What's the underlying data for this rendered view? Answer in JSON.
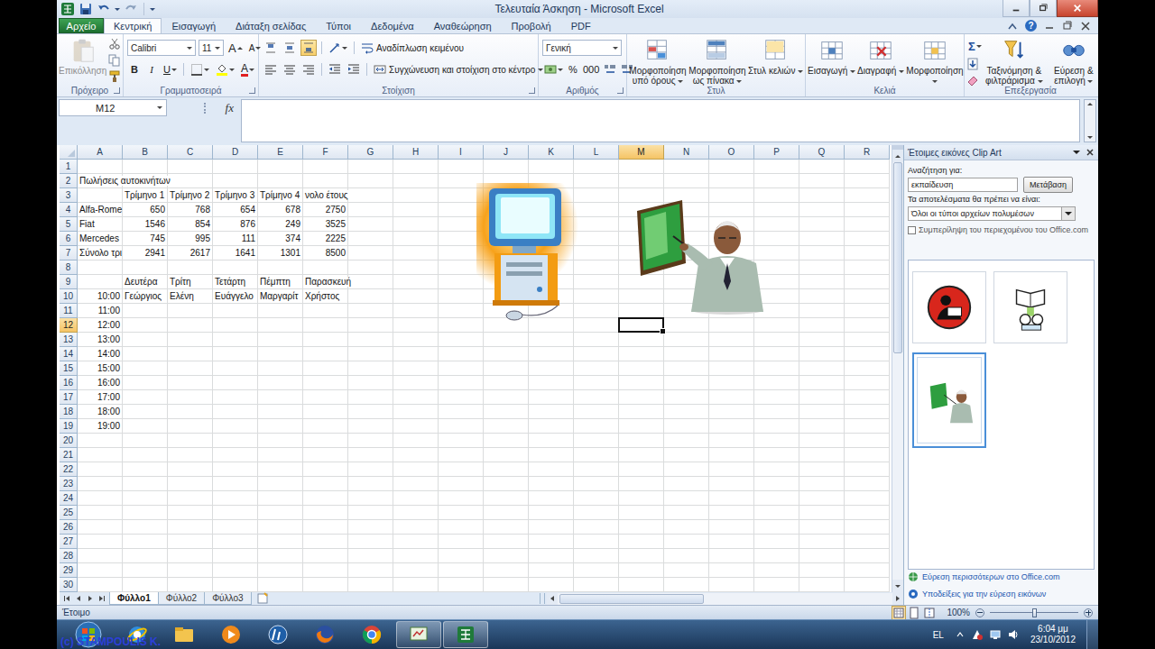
{
  "window": {
    "title": "Τελευταία Άσκηση - Microsoft Excel"
  },
  "file_tab": {
    "label": "Αρχείο"
  },
  "tabs": [
    {
      "label": "Κεντρική",
      "selected": true
    },
    {
      "label": "Εισαγωγή",
      "selected": false
    },
    {
      "label": "Διάταξη σελίδας",
      "selected": false
    },
    {
      "label": "Τύποι",
      "selected": false
    },
    {
      "label": "Δεδομένα",
      "selected": false
    },
    {
      "label": "Αναθεώρηση",
      "selected": false
    },
    {
      "label": "Προβολή",
      "selected": false
    },
    {
      "label": "PDF",
      "selected": false
    }
  ],
  "help": "?",
  "ribbon": {
    "clipboard": {
      "label": "Πρόχειρο",
      "paste": "Επικόλληση",
      "paste_disabled": true
    },
    "font": {
      "label": "Γραμματοσειρά",
      "family": "Calibri",
      "size": "11",
      "grow": "A",
      "shrink": "A",
      "bold": "B",
      "italic": "I",
      "underline": "U",
      "font_color": "A"
    },
    "alignment": {
      "label": "Στοίχιση",
      "vertical": [
        {
          "selected": false
        },
        {
          "selected": false
        },
        {
          "selected": true
        }
      ],
      "wrap": "Αναδίπλωση κειμένου",
      "merge": "Συγχώνευση και στοίχιση στο κέντρο"
    },
    "number": {
      "label": "Αριθμός",
      "format": "Γενική",
      "percent": "%",
      "thousands": "000"
    },
    "styles": {
      "label": "Στυλ",
      "buttons": [
        "Μορφοποίηση υπό όρους",
        "Μορφοποίηση ως πίνακα",
        "Στυλ κελιών"
      ]
    },
    "cells": {
      "label": "Κελιά",
      "buttons": [
        "Εισαγωγή",
        "Διαγραφή",
        "Μορφοποίηση"
      ]
    },
    "editing": {
      "label": "Επεξεργασία",
      "sum": "Σ",
      "buttons": [
        "Ταξινόμηση & φιλτράρισμα",
        "Εύρεση & επιλογή"
      ]
    }
  },
  "formula_bar": {
    "name_box": "M12",
    "fx": "fx"
  },
  "sheet": {
    "columns": [
      {
        "label": "A",
        "selected": false
      },
      {
        "label": "B",
        "selected": false
      },
      {
        "label": "C",
        "selected": false
      },
      {
        "label": "D",
        "selected": false
      },
      {
        "label": "E",
        "selected": false
      },
      {
        "label": "F",
        "selected": false
      },
      {
        "label": "G",
        "selected": false
      },
      {
        "label": "H",
        "selected": false
      },
      {
        "label": "I",
        "selected": false
      },
      {
        "label": "J",
        "selected": false
      },
      {
        "label": "K",
        "selected": false
      },
      {
        "label": "L",
        "selected": false
      },
      {
        "label": "M",
        "selected": true
      },
      {
        "label": "N",
        "selected": false
      },
      {
        "label": "O",
        "selected": false
      },
      {
        "label": "P",
        "selected": false
      },
      {
        "label": "Q",
        "selected": false
      },
      {
        "label": "R",
        "selected": false
      }
    ],
    "rows": [
      {
        "label": "1",
        "selected": false
      },
      {
        "label": "2",
        "selected": false
      },
      {
        "label": "3",
        "selected": false
      },
      {
        "label": "4",
        "selected": false
      },
      {
        "label": "5",
        "selected": false
      },
      {
        "label": "6",
        "selected": false
      },
      {
        "label": "7",
        "selected": false
      },
      {
        "label": "8",
        "selected": false
      },
      {
        "label": "9",
        "selected": false
      },
      {
        "label": "10",
        "selected": false
      },
      {
        "label": "11",
        "selected": false
      },
      {
        "label": "12",
        "selected": true
      },
      {
        "label": "13",
        "selected": false
      },
      {
        "label": "14",
        "selected": false
      },
      {
        "label": "15",
        "selected": false
      },
      {
        "label": "16",
        "selected": false
      },
      {
        "label": "17",
        "selected": false
      },
      {
        "label": "18",
        "selected": false
      },
      {
        "label": "19",
        "selected": false
      },
      {
        "label": "20",
        "selected": false
      },
      {
        "label": "21",
        "selected": false
      },
      {
        "label": "22",
        "selected": false
      },
      {
        "label": "23",
        "selected": false
      },
      {
        "label": "24",
        "selected": false
      },
      {
        "label": "25",
        "selected": false
      },
      {
        "label": "26",
        "selected": false
      },
      {
        "label": "27",
        "selected": false
      },
      {
        "label": "28",
        "selected": false
      },
      {
        "label": "29",
        "selected": false
      },
      {
        "label": "30",
        "selected": false
      }
    ],
    "active_cell": "M12",
    "cells": [
      {
        "ref": "A2",
        "text": "Πωλήσεις αυτοκινήτων",
        "kind": "text"
      },
      {
        "ref": "B3",
        "text": "Τρίμηνο 1",
        "kind": "text"
      },
      {
        "ref": "C3",
        "text": "Τρίμηνο 2",
        "kind": "text"
      },
      {
        "ref": "D3",
        "text": "Τρίμηνο 3",
        "kind": "text"
      },
      {
        "ref": "E3",
        "text": "Τρίμηνο 4",
        "kind": "text"
      },
      {
        "ref": "F3",
        "text": "νολο έτους",
        "kind": "text"
      },
      {
        "ref": "A4",
        "text": "Alfa-Rome",
        "kind": "text"
      },
      {
        "ref": "B4",
        "text": "650",
        "kind": "number"
      },
      {
        "ref": "C4",
        "text": "768",
        "kind": "number"
      },
      {
        "ref": "D4",
        "text": "654",
        "kind": "number"
      },
      {
        "ref": "E4",
        "text": "678",
        "kind": "number"
      },
      {
        "ref": "F4",
        "text": "2750",
        "kind": "number"
      },
      {
        "ref": "A5",
        "text": "Fiat",
        "kind": "text"
      },
      {
        "ref": "B5",
        "text": "1546",
        "kind": "number"
      },
      {
        "ref": "C5",
        "text": "854",
        "kind": "number"
      },
      {
        "ref": "D5",
        "text": "876",
        "kind": "number"
      },
      {
        "ref": "E5",
        "text": "249",
        "kind": "number"
      },
      {
        "ref": "F5",
        "text": "3525",
        "kind": "number"
      },
      {
        "ref": "A6",
        "text": "Mercedes",
        "kind": "text"
      },
      {
        "ref": "B6",
        "text": "745",
        "kind": "number"
      },
      {
        "ref": "C6",
        "text": "995",
        "kind": "number"
      },
      {
        "ref": "D6",
        "text": "111",
        "kind": "number"
      },
      {
        "ref": "E6",
        "text": "374",
        "kind": "number"
      },
      {
        "ref": "F6",
        "text": "2225",
        "kind": "number"
      },
      {
        "ref": "A7",
        "text": "Σύνολο τρι",
        "kind": "text"
      },
      {
        "ref": "B7",
        "text": "2941",
        "kind": "number"
      },
      {
        "ref": "C7",
        "text": "2617",
        "kind": "number"
      },
      {
        "ref": "D7",
        "text": "1641",
        "kind": "number"
      },
      {
        "ref": "E7",
        "text": "1301",
        "kind": "number"
      },
      {
        "ref": "F7",
        "text": "8500",
        "kind": "number"
      },
      {
        "ref": "B9",
        "text": "Δευτέρα",
        "kind": "text"
      },
      {
        "ref": "C9",
        "text": "Τρίτη",
        "kind": "text"
      },
      {
        "ref": "D9",
        "text": "Τετάρτη",
        "kind": "text"
      },
      {
        "ref": "E9",
        "text": "Πέμπτη",
        "kind": "text"
      },
      {
        "ref": "F9",
        "text": "Παρασκευή",
        "kind": "text"
      },
      {
        "ref": "A10",
        "text": "10:00",
        "kind": "number"
      },
      {
        "ref": "B10",
        "text": "Γεώργιος",
        "kind": "text"
      },
      {
        "ref": "C10",
        "text": "Ελένη",
        "kind": "text"
      },
      {
        "ref": "D10",
        "text": "Ευάγγελο",
        "kind": "text"
      },
      {
        "ref": "E10",
        "text": "Μαργαρίτ",
        "kind": "text"
      },
      {
        "ref": "F10",
        "text": "Χρήστος",
        "kind": "text"
      },
      {
        "ref": "A11",
        "text": "11:00",
        "kind": "number"
      },
      {
        "ref": "A12",
        "text": "12:00",
        "kind": "number"
      },
      {
        "ref": "A13",
        "text": "13:00",
        "kind": "number"
      },
      {
        "ref": "A14",
        "text": "14:00",
        "kind": "number"
      },
      {
        "ref": "A15",
        "text": "15:00",
        "kind": "number"
      },
      {
        "ref": "A16",
        "text": "16:00",
        "kind": "number"
      },
      {
        "ref": "A17",
        "text": "17:00",
        "kind": "number"
      },
      {
        "ref": "A18",
        "text": "18:00",
        "kind": "number"
      },
      {
        "ref": "A19",
        "text": "19:00",
        "kind": "number"
      }
    ]
  },
  "sheet_tabs": [
    {
      "label": "Φύλλο1",
      "selected": true
    },
    {
      "label": "Φύλλο2",
      "selected": false
    },
    {
      "label": "Φύλλο3",
      "selected": false
    }
  ],
  "task_pane": {
    "title": "Έτοιμες εικόνες Clip Art",
    "search_label": "Αναζήτηση για:",
    "search_value": "εκπαίδευση",
    "go_button": "Μετάβαση",
    "results_label": "Τα αποτελέσματα θα πρέπει να είναι:",
    "media_type": "Όλοι οι τύποι αρχείων πολυμέσων",
    "include_office": {
      "label": "Συμπερίληψη του περιεχομένου του Office.com",
      "checked": false
    },
    "results": [
      {
        "kind": "reader",
        "selected": false
      },
      {
        "kind": "books",
        "selected": false
      },
      {
        "kind": "teacher",
        "selected": true
      }
    ],
    "links": [
      "Εύρεση περισσότερων στο Office.com",
      "Υποδείξεις για την εύρεση εικόνων"
    ]
  },
  "status_bar": {
    "text": "Έτοιμο",
    "zoom": "100%",
    "zoom_level": 0.5
  },
  "taskbar": {
    "language": "EL",
    "time": "6:04 μμ",
    "date": "23/10/2012"
  },
  "watermark": "(c) STAMPOULIS K."
}
